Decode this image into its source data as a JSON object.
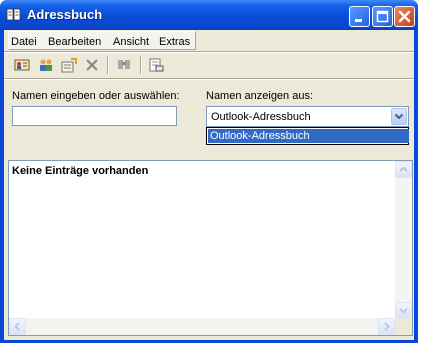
{
  "window": {
    "title": "Adressbuch",
    "icon": "address-book-icon",
    "controls": [
      "minimize-icon",
      "maximize-icon",
      "close-icon"
    ],
    "colors": {
      "titlebar": "#0a4cd6",
      "selection": "#316ac5",
      "face": "#ece9d8"
    }
  },
  "menu": {
    "items": [
      "Datei",
      "Bearbeiten",
      "Ansicht",
      "Extras"
    ]
  },
  "toolbar": {
    "icons": [
      "new-contact-icon",
      "new-group-icon",
      "properties-icon",
      "delete-icon",
      "find-people-icon",
      "send-mail-icon"
    ]
  },
  "search": {
    "label": "Namen eingeben oder auswählen:",
    "value": ""
  },
  "source": {
    "label": "Namen anzeigen aus:",
    "selected": "Outlook-Adressbuch",
    "options": [
      "Outlook-Adressbuch"
    ]
  },
  "list": {
    "empty_text": "Keine Einträge vorhanden"
  }
}
